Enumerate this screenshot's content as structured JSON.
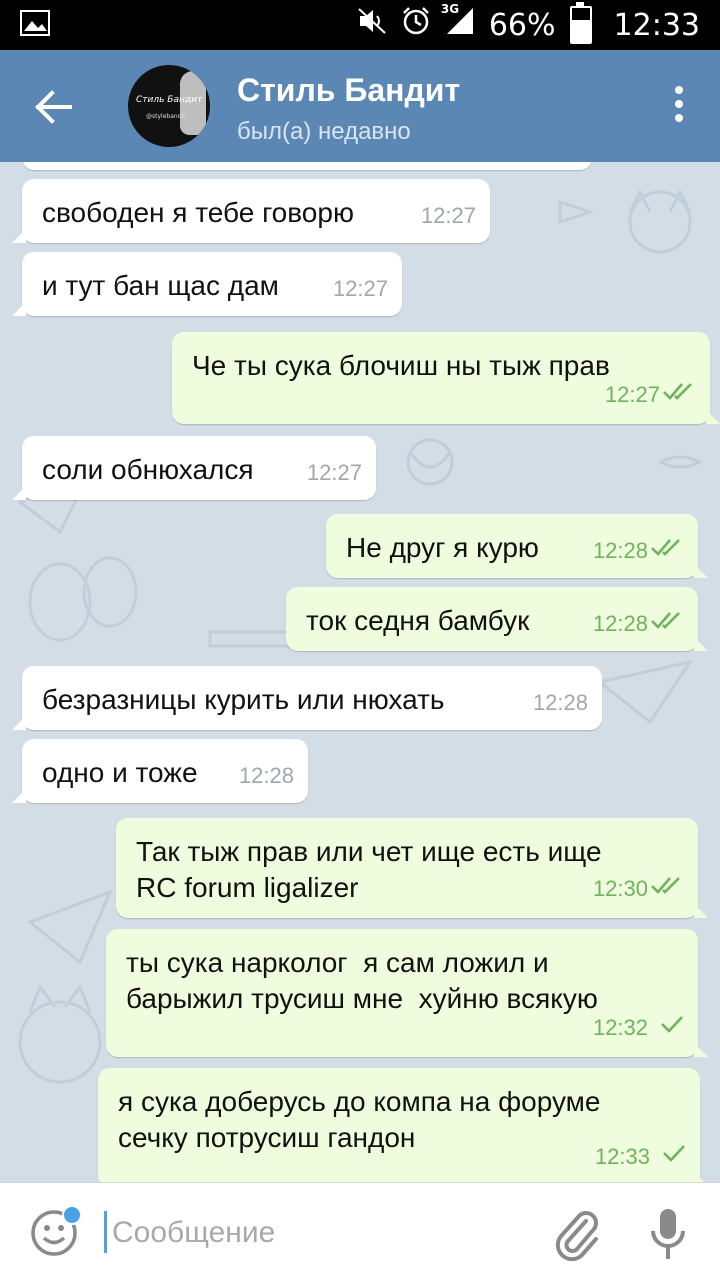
{
  "statusbar": {
    "network": "3G",
    "battery": "66%",
    "battery_level": 0.66,
    "time": "12:33"
  },
  "header": {
    "name": "Стиль Бандит",
    "status": "был(а) недавно",
    "avatar_title": "Стиль Бандит",
    "avatar_handle": "@stylebandit"
  },
  "messages": [
    {
      "text": "свободен я тебе говорю",
      "time": "12:27",
      "dir": "in"
    },
    {
      "text": "и тут бан щас дам",
      "time": "12:27",
      "dir": "in"
    },
    {
      "text": "Че ты сука блочиш ны тыж прав",
      "time": "12:27",
      "dir": "out",
      "status": "read"
    },
    {
      "text": "соли обнюхался",
      "time": "12:27",
      "dir": "in"
    },
    {
      "text": "Не друг я курю",
      "time": "12:28",
      "dir": "out",
      "status": "read"
    },
    {
      "text": "ток седня бамбук",
      "time": "12:28",
      "dir": "out",
      "status": "read"
    },
    {
      "text": "безразницы курить или нюхать",
      "time": "12:28",
      "dir": "in"
    },
    {
      "text": "одно и тоже",
      "time": "12:28",
      "dir": "in"
    },
    {
      "text": "Так тыж прав или чет ище есть ище\nRC forum ligalizer",
      "time": "12:30",
      "dir": "out",
      "status": "read"
    },
    {
      "text": "ты сука нарколог  я сам ложил и\nбарыжил трусиш мне  хуйню всякую",
      "time": "12:32",
      "dir": "out",
      "status": "sent"
    },
    {
      "text": "я сука доберусь до компа на форуме\nсечку потрусиш гандон",
      "time": "12:33",
      "dir": "out",
      "status": "sent"
    }
  ],
  "input": {
    "placeholder": "Сообщение"
  },
  "colors": {
    "header": "#5b87b4",
    "incoming": "#ffffff",
    "outgoing": "#effdde",
    "check": "#6fb35d",
    "chat_bg": "#d3dde6"
  }
}
